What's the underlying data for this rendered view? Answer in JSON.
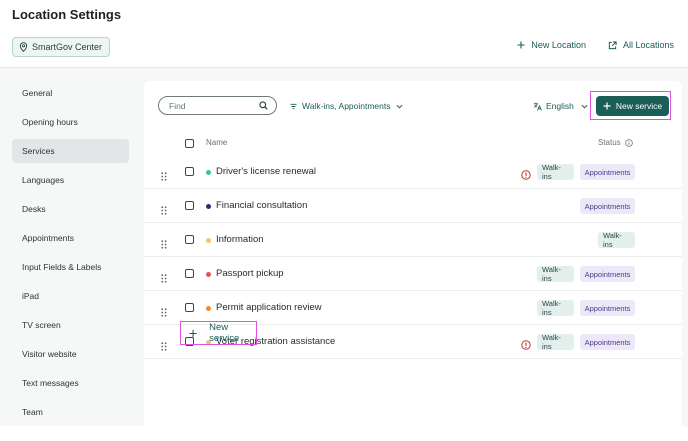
{
  "header": {
    "title": "Location Settings",
    "location_chip": "SmartGov Center",
    "new_location": "New Location",
    "all_locations": "All Locations"
  },
  "sidebar": {
    "items": [
      {
        "label": "General"
      },
      {
        "label": "Opening hours"
      },
      {
        "label": "Services",
        "active": true
      },
      {
        "label": "Languages"
      },
      {
        "label": "Desks"
      },
      {
        "label": "Appointments"
      },
      {
        "label": "Input Fields & Labels"
      },
      {
        "label": "iPad"
      },
      {
        "label": "TV screen"
      },
      {
        "label": "Visitor website"
      },
      {
        "label": "Text messages"
      },
      {
        "label": "Team"
      }
    ]
  },
  "toolbar": {
    "search_placeholder": "Find",
    "filter_label": "Walk-ins, Appointments",
    "language_label": "English",
    "new_service_label": "New service"
  },
  "table": {
    "col_name": "Name",
    "col_status": "Status",
    "rows": [
      {
        "name": "Driver's license renewal",
        "dot": "#3fbf9a",
        "warning": true,
        "badges": [
          "Walk-ins",
          "Appointments"
        ]
      },
      {
        "name": "Financial consultation",
        "dot": "#2d2a7a",
        "warning": false,
        "badges": [
          "Appointments"
        ]
      },
      {
        "name": "Information",
        "dot": "#f2c46a",
        "warning": false,
        "badges": [
          "Walk-ins"
        ]
      },
      {
        "name": "Passport pickup",
        "dot": "#e8505b",
        "warning": false,
        "badges": [
          "Walk-ins",
          "Appointments"
        ]
      },
      {
        "name": "Permit application review",
        "dot": "#f08a2e",
        "warning": false,
        "badges": [
          "Walk-ins",
          "Appointments"
        ]
      },
      {
        "name": "Voter registration assistance",
        "dot": "#f2c46a",
        "warning": true,
        "badges": [
          "Walk-ins",
          "Appointments"
        ]
      }
    ],
    "add_label": "New service"
  },
  "colors": {
    "accent": "#1b5e58",
    "walkins_badge": "#e3efec",
    "appointments_badge": "#ece8f8",
    "warning": "#c0392b",
    "highlight": "#e053e0"
  }
}
